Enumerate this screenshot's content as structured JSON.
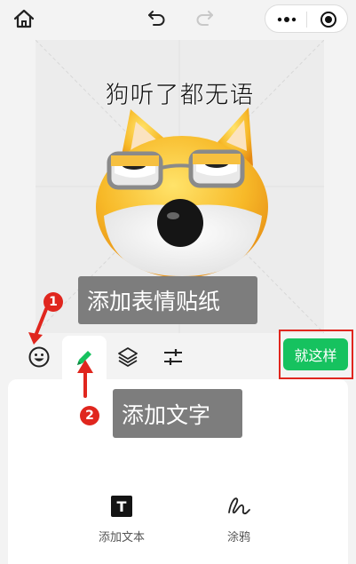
{
  "topbar": {
    "home_icon": "home-icon",
    "undo_icon": "undo-icon",
    "redo_icon": "redo-icon",
    "more_icon": "more-dots-icon",
    "close_icon": "target-close-icon"
  },
  "canvas": {
    "meme_text": "狗听了都无语",
    "sticker": "shiba-emoji-sticker"
  },
  "callouts": {
    "sticker_badge": "1",
    "sticker_label": "添加表情贴纸",
    "text_badge": "2",
    "text_label": "添加文字"
  },
  "toolbar": {
    "tools": [
      "smile-icon",
      "pen-icon",
      "layers-icon",
      "adjust-icon"
    ],
    "done_label": "就这样",
    "accent": "#16c25f",
    "highlight": "#e0261e"
  },
  "panel": {
    "options": [
      {
        "icon": "T",
        "label": "添加文本"
      },
      {
        "icon": "scribble-icon",
        "label": "涂鸦"
      }
    ]
  }
}
